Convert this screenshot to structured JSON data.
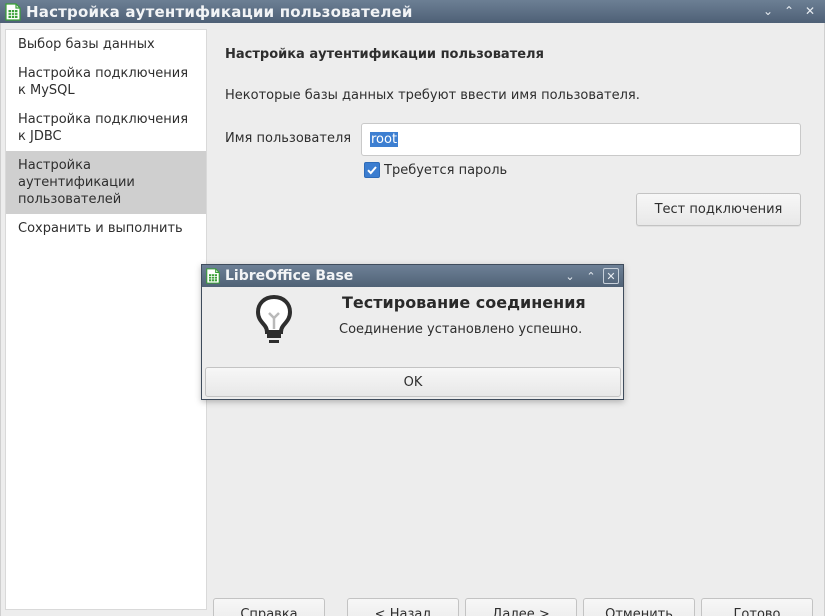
{
  "window": {
    "title": "Настройка аутентификации пользователей",
    "controls": {
      "minimize": "⌄",
      "maximize": "⌃",
      "close": "✕"
    }
  },
  "sidebar": {
    "items": [
      {
        "label": "Выбор базы данных",
        "selected": false
      },
      {
        "label": "Настройка подключения\nк MySQL",
        "selected": false
      },
      {
        "label": "Настройка подключения\nк JDBC",
        "selected": false
      },
      {
        "label": "Настройка\nаутентификации\nпользователей",
        "selected": true
      },
      {
        "label": "Сохранить и выполнить",
        "selected": false
      }
    ]
  },
  "main": {
    "section_title": "Настройка аутентификации пользователя",
    "info_text": "Некоторые базы данных требуют ввести имя пользователя.",
    "username_label": "Имя пользователя",
    "username_value": "root",
    "password_required_label": "Требуется пароль",
    "password_required_checked": true,
    "test_button": "Тест подключения"
  },
  "buttons": {
    "help": "Справка",
    "back": "< Назад",
    "next": "Далее >",
    "cancel": "Отменить",
    "finish": "Готово"
  },
  "dialog": {
    "title": "LibreOffice Base",
    "controls": {
      "minimize": "⌄",
      "maximize": "⌃",
      "close": "✕"
    },
    "heading": "Тестирование соединения",
    "message": "Соединение установлено успешно.",
    "ok_button": "OK",
    "icon": "lightbulb-icon"
  },
  "colors": {
    "titlebar": "#5a6c82",
    "selection": "#3d7fd1",
    "sidebar_selected": "#cfcfcf",
    "app_icon": "#3aa037"
  }
}
